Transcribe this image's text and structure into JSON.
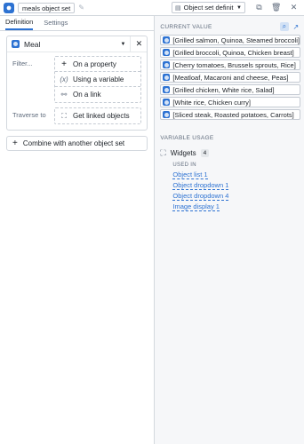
{
  "header": {
    "title": "meals object set",
    "definition_select": "Object set definition"
  },
  "tabs": [
    {
      "label": "Definition",
      "active": true
    },
    {
      "label": "Settings",
      "active": false
    }
  ],
  "definition": {
    "object_type": "Meal",
    "filter_label": "Filter...",
    "filter_options": [
      {
        "label": "On a property",
        "icon": "plus-icon"
      },
      {
        "label": "Using a variable",
        "icon": "variable-icon"
      },
      {
        "label": "On a link",
        "icon": "link-icon"
      }
    ],
    "traverse_label": "Traverse to",
    "traverse_option": "Get linked objects",
    "combine_label": "Combine with another object set"
  },
  "current_value": {
    "header": "CURRENT VALUE",
    "items": [
      "[Grilled salmon, Quinoa, Steamed broccoli]",
      "[Grilled broccoli, Quinoa, Chicken breast]",
      "[Cherry tomatoes, Brussels sprouts, Rice]",
      "[Meatloaf, Macaroni and cheese, Peas]",
      "[Grilled chicken, White rice, Salad]",
      "[White rice, Chicken curry]",
      "[Sliced steak, Roasted potatoes, Carrots]"
    ]
  },
  "variable_usage": {
    "header": "VARIABLE USAGE",
    "widgets_label": "Widgets",
    "widgets_count": "4",
    "used_in_header": "USED IN",
    "used_in": [
      "Object list 1",
      "Object dropdown 1",
      "Object dropdown 4",
      "Image display 1"
    ]
  },
  "colors": {
    "accent": "#2d72d2",
    "panel_bg": "#f6f7f9",
    "border": "#d3d8de"
  }
}
